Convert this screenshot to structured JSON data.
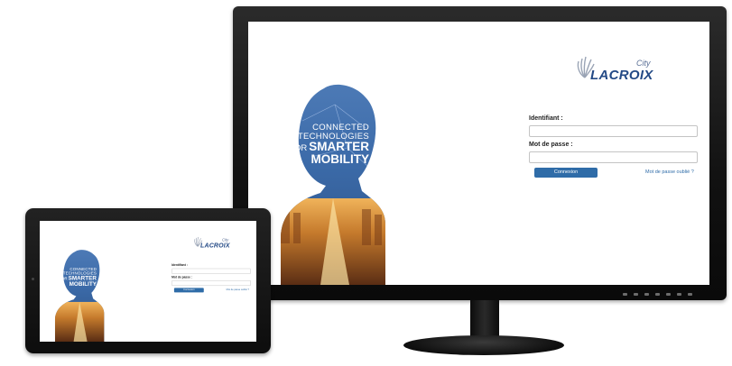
{
  "login": {
    "tagline": {
      "line1": "Connected",
      "line2": "Technologies",
      "for": "for",
      "line3": "Smarter",
      "line4": "Mobility"
    },
    "brand": {
      "name": "LACROIX",
      "suffix": "City"
    },
    "username_label": "Identifiant :",
    "username_value": "",
    "password_label": "Mot de passe :",
    "password_value": "",
    "connect_label": "Connexion",
    "forgot_label": "Mot de passe oublié ?"
  },
  "colors": {
    "accent": "#2f6ca8",
    "brand": "#244a86",
    "hero_sky": "#3b6aa8",
    "hero_city": "#c57a2c"
  }
}
